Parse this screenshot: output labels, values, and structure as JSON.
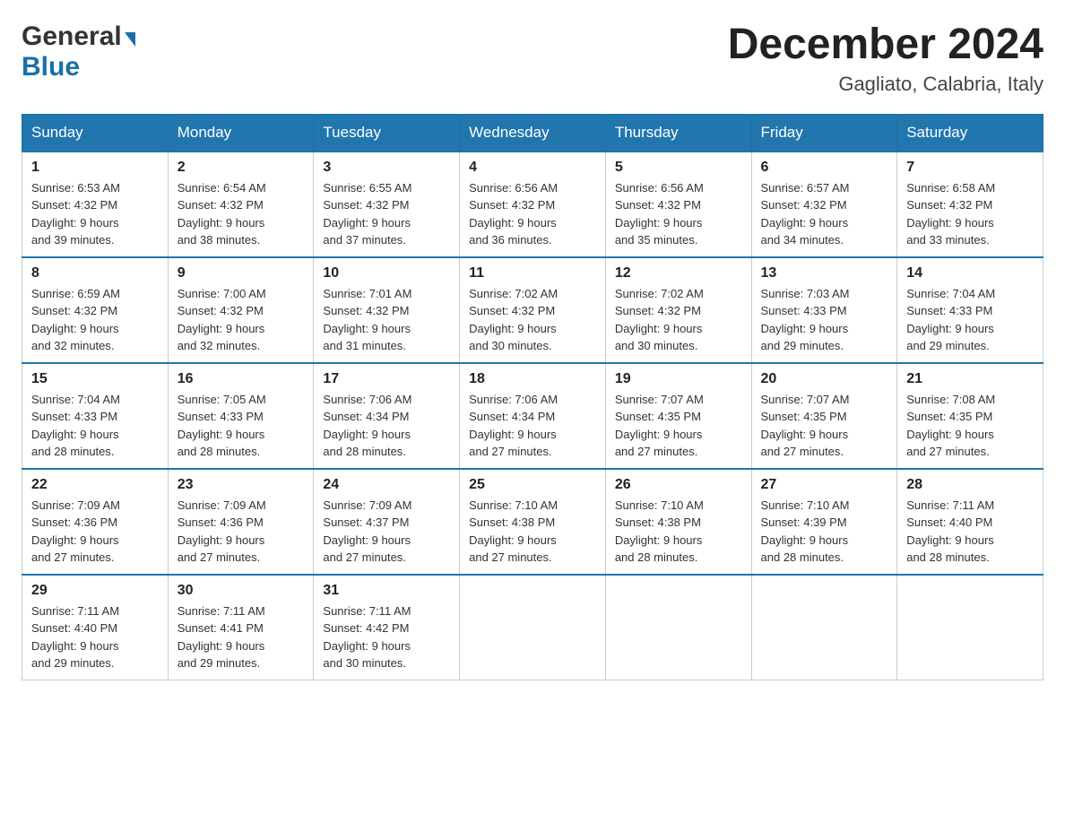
{
  "header": {
    "logo": {
      "general": "General",
      "blue": "Blue",
      "arrow": "▶"
    },
    "title": "December 2024",
    "location": "Gagliato, Calabria, Italy"
  },
  "days_of_week": [
    "Sunday",
    "Monday",
    "Tuesday",
    "Wednesday",
    "Thursday",
    "Friday",
    "Saturday"
  ],
  "weeks": [
    [
      {
        "day": "1",
        "sunrise": "6:53 AM",
        "sunset": "4:32 PM",
        "daylight": "9 hours and 39 minutes."
      },
      {
        "day": "2",
        "sunrise": "6:54 AM",
        "sunset": "4:32 PM",
        "daylight": "9 hours and 38 minutes."
      },
      {
        "day": "3",
        "sunrise": "6:55 AM",
        "sunset": "4:32 PM",
        "daylight": "9 hours and 37 minutes."
      },
      {
        "day": "4",
        "sunrise": "6:56 AM",
        "sunset": "4:32 PM",
        "daylight": "9 hours and 36 minutes."
      },
      {
        "day": "5",
        "sunrise": "6:56 AM",
        "sunset": "4:32 PM",
        "daylight": "9 hours and 35 minutes."
      },
      {
        "day": "6",
        "sunrise": "6:57 AM",
        "sunset": "4:32 PM",
        "daylight": "9 hours and 34 minutes."
      },
      {
        "day": "7",
        "sunrise": "6:58 AM",
        "sunset": "4:32 PM",
        "daylight": "9 hours and 33 minutes."
      }
    ],
    [
      {
        "day": "8",
        "sunrise": "6:59 AM",
        "sunset": "4:32 PM",
        "daylight": "9 hours and 32 minutes."
      },
      {
        "day": "9",
        "sunrise": "7:00 AM",
        "sunset": "4:32 PM",
        "daylight": "9 hours and 32 minutes."
      },
      {
        "day": "10",
        "sunrise": "7:01 AM",
        "sunset": "4:32 PM",
        "daylight": "9 hours and 31 minutes."
      },
      {
        "day": "11",
        "sunrise": "7:02 AM",
        "sunset": "4:32 PM",
        "daylight": "9 hours and 30 minutes."
      },
      {
        "day": "12",
        "sunrise": "7:02 AM",
        "sunset": "4:32 PM",
        "daylight": "9 hours and 30 minutes."
      },
      {
        "day": "13",
        "sunrise": "7:03 AM",
        "sunset": "4:33 PM",
        "daylight": "9 hours and 29 minutes."
      },
      {
        "day": "14",
        "sunrise": "7:04 AM",
        "sunset": "4:33 PM",
        "daylight": "9 hours and 29 minutes."
      }
    ],
    [
      {
        "day": "15",
        "sunrise": "7:04 AM",
        "sunset": "4:33 PM",
        "daylight": "9 hours and 28 minutes."
      },
      {
        "day": "16",
        "sunrise": "7:05 AM",
        "sunset": "4:33 PM",
        "daylight": "9 hours and 28 minutes."
      },
      {
        "day": "17",
        "sunrise": "7:06 AM",
        "sunset": "4:34 PM",
        "daylight": "9 hours and 28 minutes."
      },
      {
        "day": "18",
        "sunrise": "7:06 AM",
        "sunset": "4:34 PM",
        "daylight": "9 hours and 27 minutes."
      },
      {
        "day": "19",
        "sunrise": "7:07 AM",
        "sunset": "4:35 PM",
        "daylight": "9 hours and 27 minutes."
      },
      {
        "day": "20",
        "sunrise": "7:07 AM",
        "sunset": "4:35 PM",
        "daylight": "9 hours and 27 minutes."
      },
      {
        "day": "21",
        "sunrise": "7:08 AM",
        "sunset": "4:35 PM",
        "daylight": "9 hours and 27 minutes."
      }
    ],
    [
      {
        "day": "22",
        "sunrise": "7:09 AM",
        "sunset": "4:36 PM",
        "daylight": "9 hours and 27 minutes."
      },
      {
        "day": "23",
        "sunrise": "7:09 AM",
        "sunset": "4:36 PM",
        "daylight": "9 hours and 27 minutes."
      },
      {
        "day": "24",
        "sunrise": "7:09 AM",
        "sunset": "4:37 PM",
        "daylight": "9 hours and 27 minutes."
      },
      {
        "day": "25",
        "sunrise": "7:10 AM",
        "sunset": "4:38 PM",
        "daylight": "9 hours and 27 minutes."
      },
      {
        "day": "26",
        "sunrise": "7:10 AM",
        "sunset": "4:38 PM",
        "daylight": "9 hours and 28 minutes."
      },
      {
        "day": "27",
        "sunrise": "7:10 AM",
        "sunset": "4:39 PM",
        "daylight": "9 hours and 28 minutes."
      },
      {
        "day": "28",
        "sunrise": "7:11 AM",
        "sunset": "4:40 PM",
        "daylight": "9 hours and 28 minutes."
      }
    ],
    [
      {
        "day": "29",
        "sunrise": "7:11 AM",
        "sunset": "4:40 PM",
        "daylight": "9 hours and 29 minutes."
      },
      {
        "day": "30",
        "sunrise": "7:11 AM",
        "sunset": "4:41 PM",
        "daylight": "9 hours and 29 minutes."
      },
      {
        "day": "31",
        "sunrise": "7:11 AM",
        "sunset": "4:42 PM",
        "daylight": "9 hours and 30 minutes."
      },
      null,
      null,
      null,
      null
    ]
  ]
}
